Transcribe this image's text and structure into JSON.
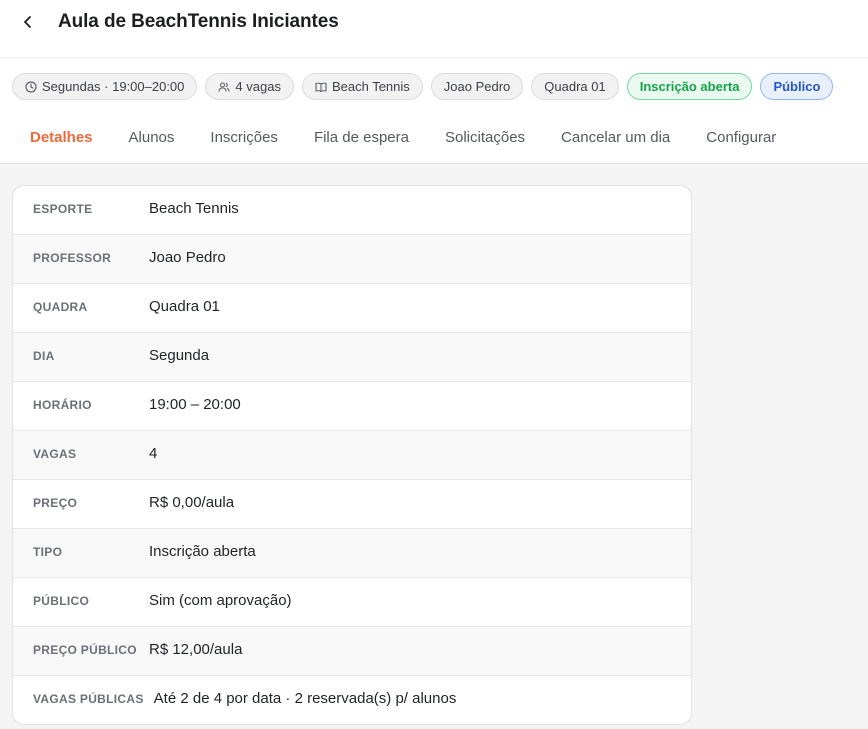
{
  "header": {
    "title": "Aula de BeachTennis Iniciantes",
    "back_icon": "chevron-left-icon"
  },
  "chips": [
    {
      "name": "schedule",
      "label": "Segundas · 19:00–20:00",
      "icon": "clock-icon"
    },
    {
      "name": "spots",
      "label": "4 vagas",
      "icon": "users-icon"
    },
    {
      "name": "sport",
      "label": "Beach Tennis",
      "icon": "book-icon"
    },
    {
      "name": "teacher",
      "label": "Joao Pedro"
    },
    {
      "name": "court",
      "label": "Quadra 01"
    },
    {
      "name": "enrollment",
      "label": "Inscrição aberta",
      "color": "#16a34a"
    },
    {
      "name": "visibility",
      "label": "Público",
      "color": "#2456c7"
    }
  ],
  "tabs": [
    {
      "label": "Detalhes",
      "active": true
    },
    {
      "label": "Alunos"
    },
    {
      "label": "Inscrições"
    },
    {
      "label": "Fila de espera"
    },
    {
      "label": "Solicitações"
    },
    {
      "label": "Cancelar um dia"
    },
    {
      "label": "Configurar"
    }
  ],
  "details": [
    {
      "label": "ESPORTE",
      "value": "Beach Tennis"
    },
    {
      "label": "PROFESSOR",
      "value": "Joao Pedro"
    },
    {
      "label": "QUADRA",
      "value": "Quadra 01"
    },
    {
      "label": "DIA",
      "value": "Segunda"
    },
    {
      "label": "HORÁRIO",
      "value": "19:00 – 20:00"
    },
    {
      "label": "VAGAS",
      "value": "4"
    },
    {
      "label": "PREÇO",
      "value": "R$ 0,00/aula"
    },
    {
      "label": "TIPO",
      "value": "Inscrição aberta"
    },
    {
      "label": "PÚBLICO",
      "value": "Sim (com aprovação)"
    },
    {
      "label": "PREÇO PÚBLICO",
      "value": "R$ 12,00/aula"
    },
    {
      "label": "VAGAS PÚBLICAS",
      "value": "Até 2 de 4 por data · 2 reservada(s) p/ alunos"
    }
  ],
  "colors": {
    "accent": "#ea6a3c",
    "success": "#16a34a",
    "info": "#2456c7"
  }
}
